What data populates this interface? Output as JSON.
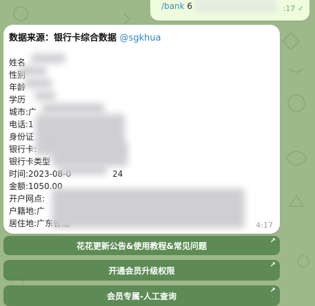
{
  "sent_message": {
    "command": "/bank",
    "tail": "6",
    "time": ":17",
    "check_icon": "double-check-icon"
  },
  "result": {
    "header_label": "数据来源：银行卡综合数据",
    "header_mention": "@sgkhua",
    "fields": [
      {
        "label": "姓名"
      },
      {
        "label": "性别"
      },
      {
        "label": "年龄"
      },
      {
        "label": "学历"
      },
      {
        "label": "城市:",
        "value": "广"
      },
      {
        "label": "电话:",
        "value": "1"
      },
      {
        "label": "身份证"
      },
      {
        "label": "银行卡:"
      },
      {
        "label": "银行卡类型"
      },
      {
        "label": "时间:",
        "value": "2023-08-0",
        "suffix": "24"
      },
      {
        "label": "金额:",
        "value": "1050.00"
      },
      {
        "label": "开户网点:"
      },
      {
        "label": "户籍地:",
        "value": "广"
      },
      {
        "label": "居住地:",
        "value": "广东省汕"
      }
    ],
    "time": "4:17"
  },
  "keyboard": {
    "buttons": [
      {
        "label": "花花更新公告&使用教程&常见问题",
        "icon": "arrow-up-right-icon"
      },
      {
        "label": "开通会员升级权限",
        "icon": "arrow-up-right-icon"
      },
      {
        "label": "会员专属-人工查询",
        "icon": "arrow-up-right-icon"
      }
    ]
  },
  "colors": {
    "background": "#9db889",
    "mention": "#2a86c9",
    "button": "#4c7d46",
    "outgoing_bubble": "#effdde"
  }
}
